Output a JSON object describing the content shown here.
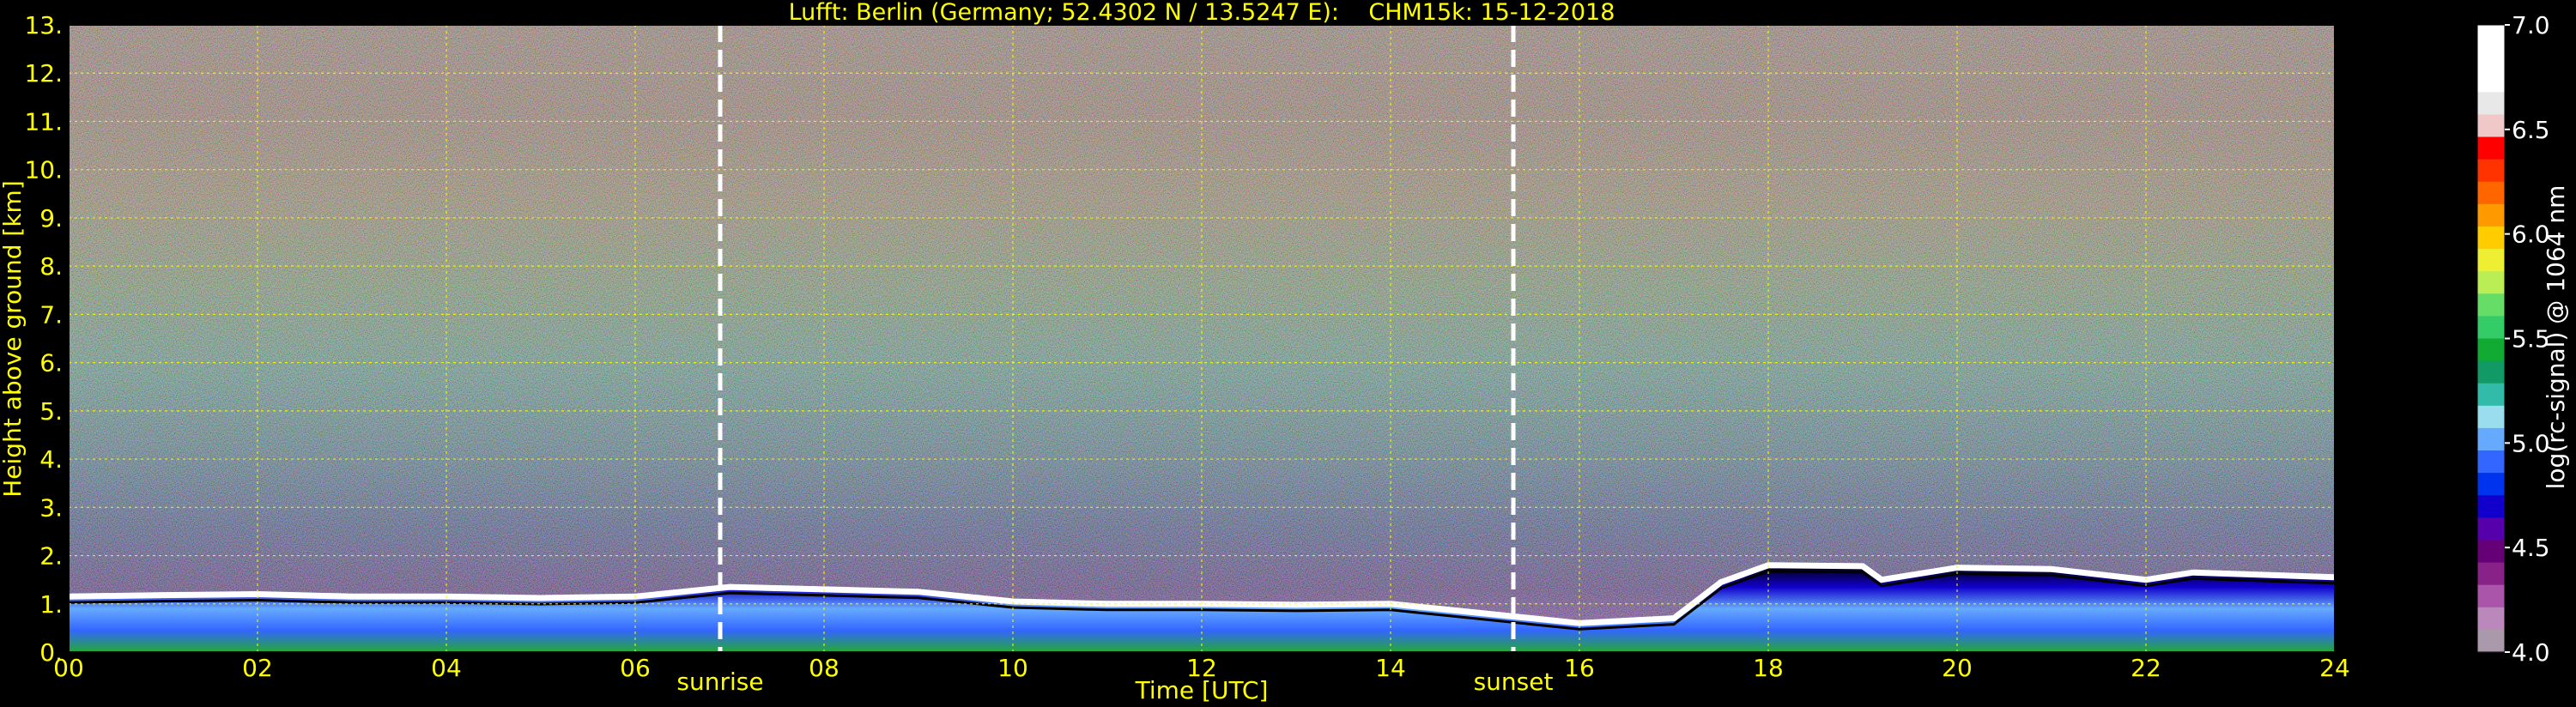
{
  "chart_data": {
    "type": "heatmap",
    "title": "Lufft: Berlin (Germany; 52.4302 N / 13.5247 E):    CHM15k: 15-12-2018",
    "xlabel": "Time [UTC]",
    "ylabel": "Height above ground [km]",
    "xlim": [
      0,
      24
    ],
    "ylim": [
      0,
      13
    ],
    "x_tick_labels": [
      "00",
      "02",
      "04",
      "06",
      "08",
      "10",
      "12",
      "14",
      "16",
      "18",
      "20",
      "22",
      "24"
    ],
    "y_tick_labels": [
      "0.",
      "1.",
      "2.",
      "3.",
      "4.",
      "5.",
      "6.",
      "7.",
      "8.",
      "9.",
      "10.",
      "11.",
      "12.",
      "13."
    ],
    "grid": true,
    "grid_color": "#ffff00",
    "annotations": [
      {
        "label": "sunrise",
        "x": 6.9
      },
      {
        "label": "sunset",
        "x": 15.3
      }
    ],
    "colorbar": {
      "label": "log(rc-signal) @ 1064 nm",
      "range": [
        4.0,
        7.0
      ],
      "tick_labels": [
        "7.0",
        "6.5",
        "6.0",
        "5.5",
        "5.0",
        "4.5",
        "4.0"
      ],
      "colors": [
        "#ffffff",
        "#ffffff",
        "#ffffff",
        "#e8e8e8",
        "#f0c8c8",
        "#ff0000",
        "#ff3300",
        "#ff6600",
        "#ff9900",
        "#ffcc00",
        "#eeee33",
        "#bbee55",
        "#66dd66",
        "#33cc66",
        "#11aa33",
        "#119966",
        "#33bbaa",
        "#99ddee",
        "#66aaff",
        "#3366ff",
        "#0033ee",
        "#1100cc",
        "#5500aa",
        "#660077",
        "#882288",
        "#aa55aa",
        "#bb88bb",
        "#aa99aa"
      ]
    },
    "boundary_layer_top_km": [
      {
        "t": 0,
        "h": 1.15
      },
      {
        "t": 1,
        "h": 1.18
      },
      {
        "t": 2,
        "h": 1.2
      },
      {
        "t": 3,
        "h": 1.15
      },
      {
        "t": 4,
        "h": 1.15
      },
      {
        "t": 5,
        "h": 1.12
      },
      {
        "t": 6,
        "h": 1.15
      },
      {
        "t": 7,
        "h": 1.35
      },
      {
        "t": 8,
        "h": 1.3
      },
      {
        "t": 9,
        "h": 1.25
      },
      {
        "t": 10,
        "h": 1.05
      },
      {
        "t": 11,
        "h": 1.0
      },
      {
        "t": 12,
        "h": 1.0
      },
      {
        "t": 13,
        "h": 0.98
      },
      {
        "t": 14,
        "h": 1.0
      },
      {
        "t": 14.5,
        "h": 0.9
      },
      {
        "t": 16,
        "h": 0.6
      },
      {
        "t": 17,
        "h": 0.7
      },
      {
        "t": 17.5,
        "h": 1.45
      },
      {
        "t": 18,
        "h": 1.8
      },
      {
        "t": 19,
        "h": 1.78
      },
      {
        "t": 19.2,
        "h": 1.5
      },
      {
        "t": 20,
        "h": 1.75
      },
      {
        "t": 21,
        "h": 1.72
      },
      {
        "t": 22,
        "h": 1.5
      },
      {
        "t": 22.5,
        "h": 1.65
      },
      {
        "t": 24,
        "h": 1.55
      }
    ]
  }
}
